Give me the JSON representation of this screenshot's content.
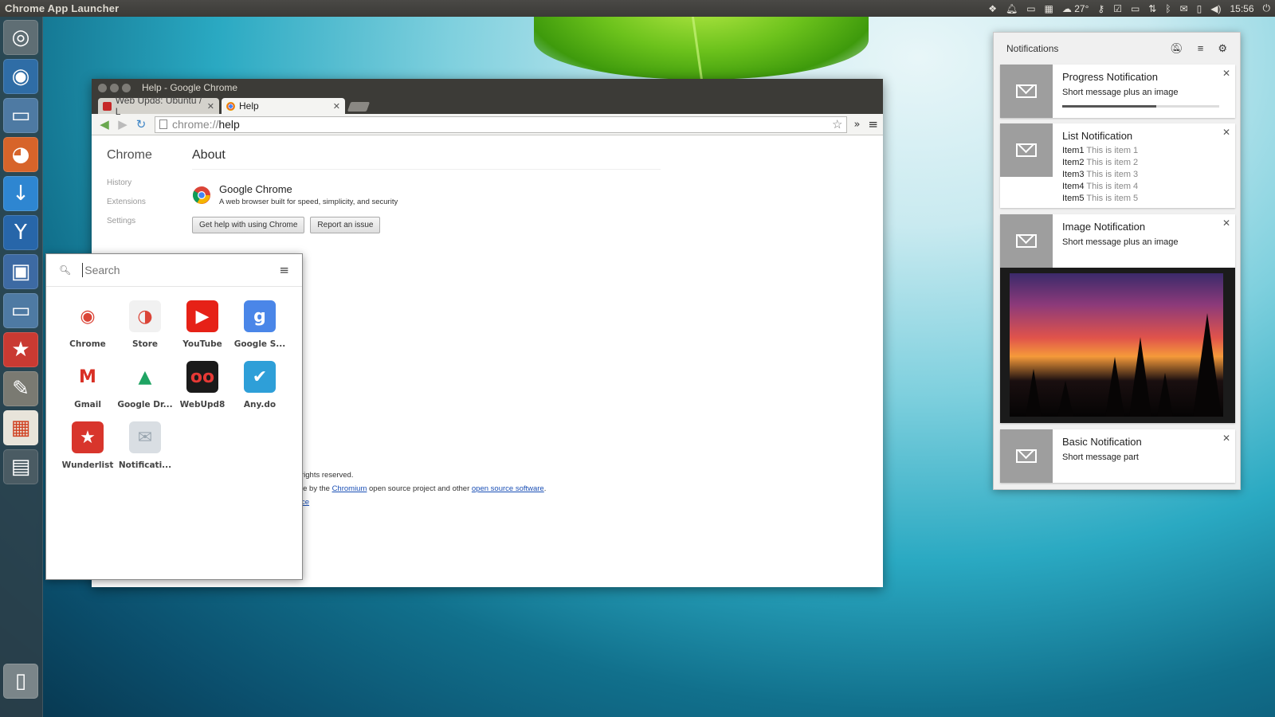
{
  "top_panel": {
    "app_title": "Chrome App Launcher",
    "temperature": "27°",
    "clock": "15:56"
  },
  "launcher": {
    "items": [
      {
        "name": "dash-home",
        "glyph": "◎",
        "color": "#5f6e74"
      },
      {
        "name": "chrome",
        "glyph": "◉",
        "color": "#2f6da6"
      },
      {
        "name": "files",
        "glyph": "▭",
        "color": "#4e7aa3"
      },
      {
        "name": "firefox",
        "glyph": "◕",
        "color": "#d7642a"
      },
      {
        "name": "downloader",
        "glyph": "↓",
        "color": "#2e86d1"
      },
      {
        "name": "y-ppa-manager",
        "glyph": "Y",
        "color": "#2766a9"
      },
      {
        "name": "virtualbox",
        "glyph": "▣",
        "color": "#3d6aa3"
      },
      {
        "name": "file-manager",
        "glyph": "▭",
        "color": "#4e7aa3"
      },
      {
        "name": "wunderlist",
        "glyph": "★",
        "color": "#c93a32"
      },
      {
        "name": "text-editor",
        "glyph": "✎",
        "color": "#7a7a72"
      },
      {
        "name": "app-launcher",
        "glyph": "▦",
        "color": "#e8e4da"
      },
      {
        "name": "workspaces",
        "glyph": "▤",
        "color": "#4a5b63"
      }
    ],
    "trash": {
      "glyph": "▯",
      "color": "#7a8589"
    }
  },
  "chrome_window": {
    "title": "Help - Google Chrome",
    "tabs": [
      {
        "label": "Web Upd8: Ubuntu / L",
        "active": false
      },
      {
        "label": "Help",
        "active": true
      }
    ],
    "url_scheme": "chrome://",
    "url_path": "help",
    "page": {
      "brand": "Chrome",
      "nav": [
        "History",
        "Extensions",
        "Settings"
      ],
      "heading": "About",
      "product_name": "Google Chrome",
      "product_desc": "A web browser built for speed, simplicity, and security",
      "buttons": [
        "Get help with using Chrome",
        "Report an issue"
      ],
      "legal": {
        "line1": "rights reserved.",
        "line2_pre": "le by the ",
        "line2_link1": "Chromium",
        "line2_mid": " open source project and other ",
        "line2_link2": "open source software",
        "line2_post": ".",
        "line3_link": "ce"
      }
    }
  },
  "app_launcher": {
    "search_placeholder": "Search",
    "apps": [
      {
        "label": "Chrome",
        "glyph": "◉",
        "bg": "#ffffff",
        "fg": "#db4437"
      },
      {
        "label": "Store",
        "glyph": "◑",
        "bg": "#f1f1f1",
        "fg": "#db4437"
      },
      {
        "label": "YouTube",
        "glyph": "▶",
        "bg": "#e62117",
        "fg": "#ffffff"
      },
      {
        "label": "Google S...",
        "glyph": "g",
        "bg": "#4a86e8",
        "fg": "#ffffff"
      },
      {
        "label": "Gmail",
        "glyph": "M",
        "bg": "#ffffff",
        "fg": "#d93025"
      },
      {
        "label": "Google Dr...",
        "glyph": "▲",
        "bg": "#ffffff",
        "fg": "#1fa463"
      },
      {
        "label": "WebUpd8",
        "glyph": "oo",
        "bg": "#1a1a1a",
        "fg": "#e53935"
      },
      {
        "label": "Any.do",
        "glyph": "✔",
        "bg": "#2e9fd8",
        "fg": "#ffffff"
      },
      {
        "label": "Wunderlist",
        "glyph": "★",
        "bg": "#d8352c",
        "fg": "#ffffff"
      },
      {
        "label": "Notificati...",
        "glyph": "✉",
        "bg": "#d9dee3",
        "fg": "#9aa6b0"
      }
    ]
  },
  "notifications": {
    "header": "Notifications",
    "cards": [
      {
        "type": "progress",
        "title": "Progress Notification",
        "message": "Short message plus an image",
        "progress": 0.6
      },
      {
        "type": "list",
        "title": "List Notification",
        "items": [
          {
            "key": "Item1",
            "value": "This is item 1"
          },
          {
            "key": "Item2",
            "value": "This is item 2"
          },
          {
            "key": "Item3",
            "value": "This is item 3"
          },
          {
            "key": "Item4",
            "value": "This is item 4"
          },
          {
            "key": "Item5",
            "value": "This is item 5"
          }
        ]
      },
      {
        "type": "image",
        "title": "Image Notification",
        "message": "Short message plus an image"
      },
      {
        "type": "basic",
        "title": "Basic Notification",
        "message": "Short message part"
      }
    ]
  }
}
